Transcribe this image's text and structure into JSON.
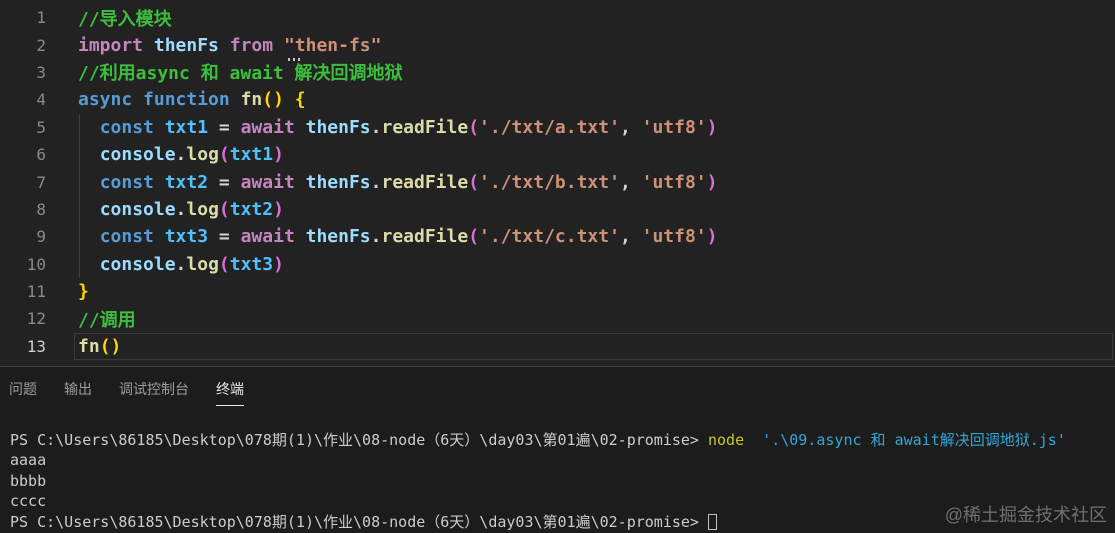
{
  "palette": {
    "editor_bg": "#222222",
    "panel_bg": "#1c1c1c",
    "divider": "#3f3f3f",
    "indent_guide": "#3d3d3d",
    "active_line_border": "#3a3a3a",
    "comment": "#3dbe3d",
    "keyword_blue": "#569cd6",
    "keyword_purple": "#c586c0",
    "variable": "#9cdcfe",
    "const_var": "#4fc1ff",
    "function": "#dcdcaa",
    "string": "#ce9178",
    "plain": "#d4d4d4",
    "bracket_gold": "#ffd700",
    "bracket_magenta": "#da70d6",
    "line_number": "#8a8a8a",
    "line_number_active": "#cccccc",
    "tab_inactive": "#9b9b9b",
    "tab_active": "#e7e7e7",
    "term_text": "#cccccc",
    "term_command": "#c9c91f",
    "term_string": "#35a6d5",
    "term_cursor": "#c0c0c0",
    "watermark": "#6f6f6f"
  },
  "editor": {
    "lines": [
      {
        "num": "1",
        "indent": false,
        "active": false,
        "tokens": [
          {
            "t": "//导入模块",
            "c": "comment"
          }
        ]
      },
      {
        "num": "2",
        "indent": false,
        "active": false,
        "tokens": [
          {
            "t": "import",
            "c": "kwp"
          },
          {
            "t": " ",
            "c": "plain"
          },
          {
            "t": "thenFs",
            "c": "var"
          },
          {
            "t": " ",
            "c": "plain"
          },
          {
            "t": "from",
            "c": "kwp"
          },
          {
            "t": " ",
            "c": "plain"
          },
          {
            "t": "\"then-fs\"",
            "c": "string",
            "hint": true
          }
        ]
      },
      {
        "num": "3",
        "indent": false,
        "active": false,
        "tokens": [
          {
            "t": "//利用async 和 await 解决回调地狱",
            "c": "comment"
          }
        ]
      },
      {
        "num": "4",
        "indent": false,
        "active": false,
        "tokens": [
          {
            "t": "async",
            "c": "kwb"
          },
          {
            "t": " ",
            "c": "plain"
          },
          {
            "t": "function",
            "c": "kwb"
          },
          {
            "t": " ",
            "c": "plain"
          },
          {
            "t": "fn",
            "c": "fn"
          },
          {
            "t": "()",
            "c": "b1"
          },
          {
            "t": " ",
            "c": "plain"
          },
          {
            "t": "{",
            "c": "b1"
          }
        ]
      },
      {
        "num": "5",
        "indent": true,
        "active": false,
        "tokens": [
          {
            "t": "  ",
            "c": "plain"
          },
          {
            "t": "const",
            "c": "kwb"
          },
          {
            "t": " ",
            "c": "plain"
          },
          {
            "t": "txt1",
            "c": "cvar"
          },
          {
            "t": " = ",
            "c": "plain"
          },
          {
            "t": "await",
            "c": "kwp"
          },
          {
            "t": " ",
            "c": "plain"
          },
          {
            "t": "thenFs",
            "c": "var"
          },
          {
            "t": ".",
            "c": "plain"
          },
          {
            "t": "readFile",
            "c": "fn"
          },
          {
            "t": "(",
            "c": "b2"
          },
          {
            "t": "'./txt/a.txt'",
            "c": "string"
          },
          {
            "t": ", ",
            "c": "plain"
          },
          {
            "t": "'utf8'",
            "c": "string"
          },
          {
            "t": ")",
            "c": "b2"
          }
        ]
      },
      {
        "num": "6",
        "indent": true,
        "active": false,
        "tokens": [
          {
            "t": "  ",
            "c": "plain"
          },
          {
            "t": "console",
            "c": "var"
          },
          {
            "t": ".",
            "c": "plain"
          },
          {
            "t": "log",
            "c": "fn"
          },
          {
            "t": "(",
            "c": "b2"
          },
          {
            "t": "txt1",
            "c": "cvar"
          },
          {
            "t": ")",
            "c": "b2"
          }
        ]
      },
      {
        "num": "7",
        "indent": true,
        "active": false,
        "tokens": [
          {
            "t": "  ",
            "c": "plain"
          },
          {
            "t": "const",
            "c": "kwb"
          },
          {
            "t": " ",
            "c": "plain"
          },
          {
            "t": "txt2",
            "c": "cvar"
          },
          {
            "t": " = ",
            "c": "plain"
          },
          {
            "t": "await",
            "c": "kwp"
          },
          {
            "t": " ",
            "c": "plain"
          },
          {
            "t": "thenFs",
            "c": "var"
          },
          {
            "t": ".",
            "c": "plain"
          },
          {
            "t": "readFile",
            "c": "fn"
          },
          {
            "t": "(",
            "c": "b2"
          },
          {
            "t": "'./txt/b.txt'",
            "c": "string"
          },
          {
            "t": ", ",
            "c": "plain"
          },
          {
            "t": "'utf8'",
            "c": "string"
          },
          {
            "t": ")",
            "c": "b2"
          }
        ]
      },
      {
        "num": "8",
        "indent": true,
        "active": false,
        "tokens": [
          {
            "t": "  ",
            "c": "plain"
          },
          {
            "t": "console",
            "c": "var"
          },
          {
            "t": ".",
            "c": "plain"
          },
          {
            "t": "log",
            "c": "fn"
          },
          {
            "t": "(",
            "c": "b2"
          },
          {
            "t": "txt2",
            "c": "cvar"
          },
          {
            "t": ")",
            "c": "b2"
          }
        ]
      },
      {
        "num": "9",
        "indent": true,
        "active": false,
        "tokens": [
          {
            "t": "  ",
            "c": "plain"
          },
          {
            "t": "const",
            "c": "kwb"
          },
          {
            "t": " ",
            "c": "plain"
          },
          {
            "t": "txt3",
            "c": "cvar"
          },
          {
            "t": " = ",
            "c": "plain"
          },
          {
            "t": "await",
            "c": "kwp"
          },
          {
            "t": " ",
            "c": "plain"
          },
          {
            "t": "thenFs",
            "c": "var"
          },
          {
            "t": ".",
            "c": "plain"
          },
          {
            "t": "readFile",
            "c": "fn"
          },
          {
            "t": "(",
            "c": "b2"
          },
          {
            "t": "'./txt/c.txt'",
            "c": "string"
          },
          {
            "t": ", ",
            "c": "plain"
          },
          {
            "t": "'utf8'",
            "c": "string"
          },
          {
            "t": ")",
            "c": "b2"
          }
        ]
      },
      {
        "num": "10",
        "indent": true,
        "active": false,
        "tokens": [
          {
            "t": "  ",
            "c": "plain"
          },
          {
            "t": "console",
            "c": "var"
          },
          {
            "t": ".",
            "c": "plain"
          },
          {
            "t": "log",
            "c": "fn"
          },
          {
            "t": "(",
            "c": "b2"
          },
          {
            "t": "txt3",
            "c": "cvar"
          },
          {
            "t": ")",
            "c": "b2"
          }
        ]
      },
      {
        "num": "11",
        "indent": false,
        "active": false,
        "tokens": [
          {
            "t": "}",
            "c": "b1"
          }
        ]
      },
      {
        "num": "12",
        "indent": false,
        "active": false,
        "tokens": [
          {
            "t": "//调用",
            "c": "comment"
          }
        ]
      },
      {
        "num": "13",
        "indent": false,
        "active": true,
        "tokens": [
          {
            "t": "fn",
            "c": "fn"
          },
          {
            "t": "()",
            "c": "b1"
          }
        ]
      }
    ]
  },
  "panel": {
    "tabs": [
      {
        "name": "problems",
        "label": "问题",
        "active": false
      },
      {
        "name": "output",
        "label": "输出",
        "active": false
      },
      {
        "name": "debug-console",
        "label": "调试控制台",
        "active": false
      },
      {
        "name": "terminal",
        "label": "终端",
        "active": true
      }
    ]
  },
  "terminal": {
    "lines": [
      {
        "tokens": [
          {
            "t": "PS C:\\Users\\86185\\Desktop\\078期(1)\\作业\\08-node（6天）\\day03\\第01遍\\02-promise>",
            "c": "tp"
          },
          {
            "t": " ",
            "c": "tp"
          },
          {
            "t": "node",
            "c": "ty"
          },
          {
            "t": "  ",
            "c": "tp"
          },
          {
            "t": "'.\\09.async 和 await解决回调地狱.js'",
            "c": "tc"
          }
        ]
      },
      {
        "tokens": [
          {
            "t": "aaaa",
            "c": "tp"
          }
        ]
      },
      {
        "tokens": [
          {
            "t": "bbbb",
            "c": "tp"
          }
        ]
      },
      {
        "tokens": [
          {
            "t": "cccc",
            "c": "tp"
          }
        ]
      },
      {
        "tokens": [
          {
            "t": "PS C:\\Users\\86185\\Desktop\\078期(1)\\作业\\08-node（6天）\\day03\\第01遍\\02-promise>",
            "c": "tp"
          },
          {
            "t": " ",
            "c": "tp"
          },
          {
            "t": "",
            "c": "cursor"
          }
        ]
      }
    ]
  },
  "watermark": "@稀土掘金技术社区"
}
